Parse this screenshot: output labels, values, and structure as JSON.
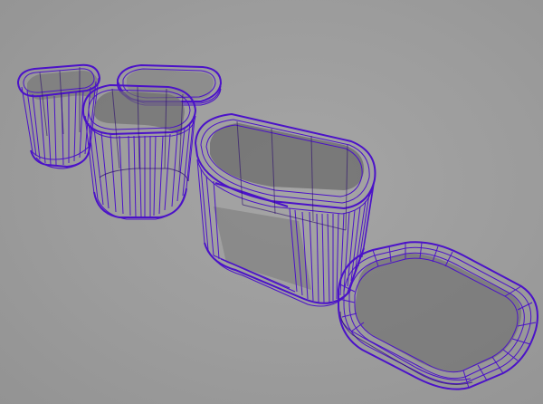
{
  "viewport": {
    "background": "#9c9c9c",
    "wireframe_color": "#4b12c8",
    "wireframe_dark_color": "#2a0a6e",
    "interior_shade": "#6e6e6e"
  },
  "objects": [
    {
      "name": "small-canister-wireframe"
    },
    {
      "name": "medium-canister-wireframe"
    },
    {
      "name": "medium-canister-lid-wireframe"
    },
    {
      "name": "large-container-wireframe"
    },
    {
      "name": "large-container-lid-wireframe"
    }
  ]
}
